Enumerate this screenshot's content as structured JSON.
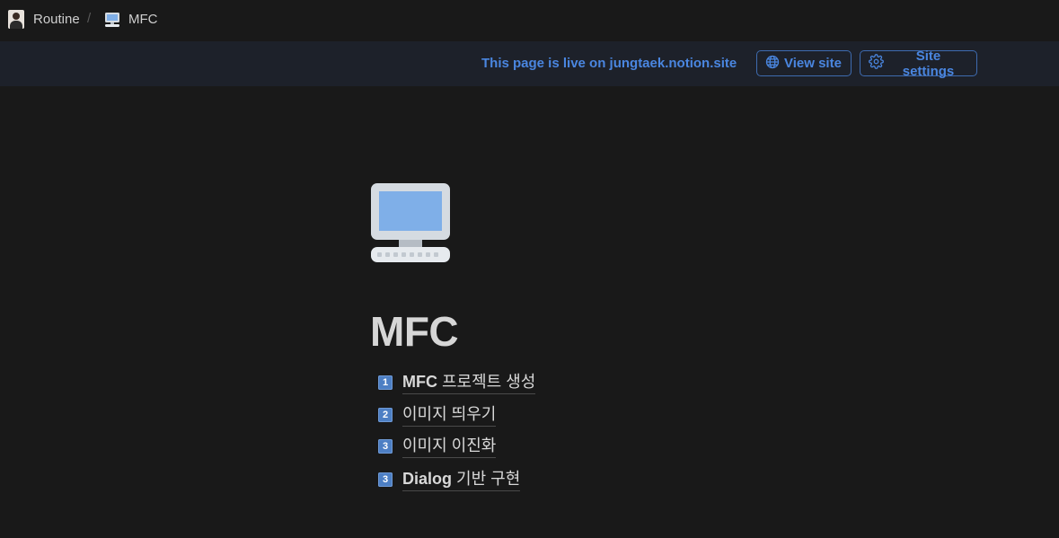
{
  "breadcrumb": {
    "workspace": "Routine",
    "separator": "/",
    "page": "MFC"
  },
  "banner": {
    "text": "This page is live on jungtaek.notion.site",
    "view_site": "View site",
    "site_settings": "Site settings",
    "accent_color": "#4a86e0"
  },
  "page": {
    "icon": "desktop-computer-icon",
    "title": "MFC"
  },
  "items": [
    {
      "badge": "1",
      "bold": "MFC",
      "text": " 프로젝트 생성"
    },
    {
      "badge": "2",
      "bold": "",
      "text": "이미지 띄우기"
    },
    {
      "badge": "3",
      "bold": "",
      "text": "이미지 이진화"
    },
    {
      "badge": "3",
      "bold": "Dialog",
      "text": " 기반 구현"
    }
  ]
}
